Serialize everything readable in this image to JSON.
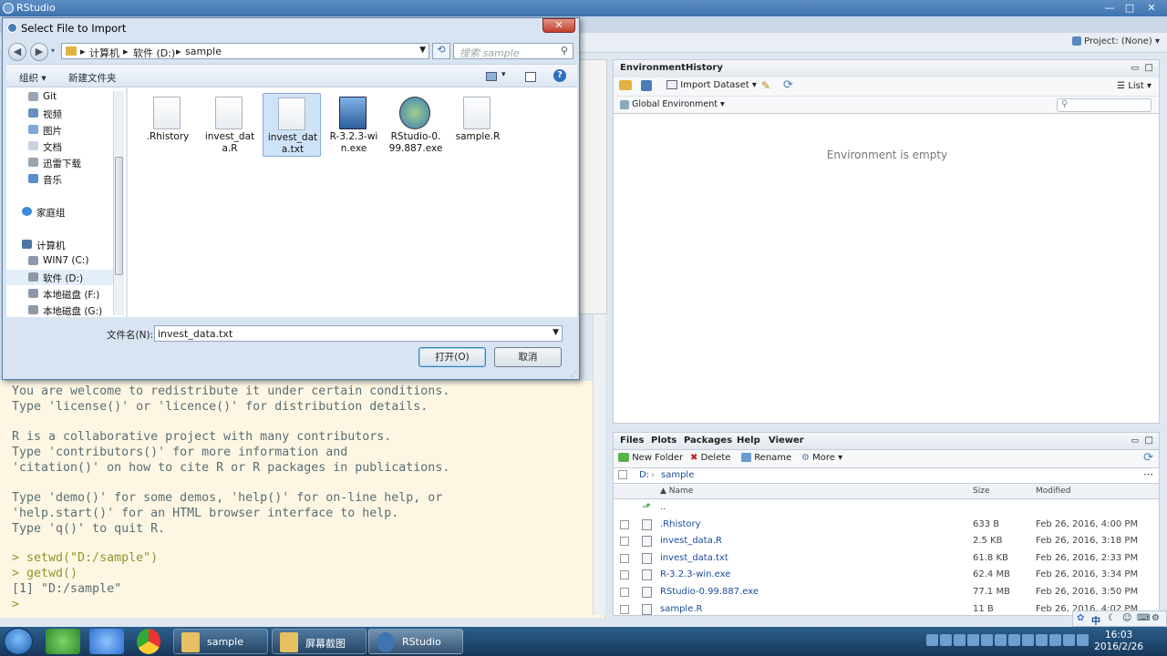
{
  "app": {
    "title": "RStudio",
    "project_label": "Project: (None)"
  },
  "env_pane": {
    "tabs": [
      "Environment",
      "History"
    ],
    "import_label": "Import Dataset",
    "list_label": "List",
    "scope_label": "Global Environment",
    "empty_text": "Environment is empty"
  },
  "files_pane": {
    "tabs": [
      "Files",
      "Plots",
      "Packages",
      "Help",
      "Viewer"
    ],
    "tools": {
      "new_folder": "New Folder",
      "delete": "Delete",
      "rename": "Rename",
      "more": "More"
    },
    "path": [
      "D:",
      "sample"
    ],
    "columns": {
      "name": "Name",
      "size": "Size",
      "modified": "Modified"
    },
    "parent_label": "..",
    "rows": [
      {
        "name": ".Rhistory",
        "size": "633 B",
        "modified": "Feb 26, 2016, 4:00 PM"
      },
      {
        "name": "invest_data.R",
        "size": "2.5 KB",
        "modified": "Feb 26, 2016, 3:18 PM"
      },
      {
        "name": "invest_data.txt",
        "size": "61.8 KB",
        "modified": "Feb 26, 2016, 2:33 PM"
      },
      {
        "name": "R-3.2.3-win.exe",
        "size": "62.4 MB",
        "modified": "Feb 26, 2016, 3:34 PM"
      },
      {
        "name": "RStudio-0.99.887.exe",
        "size": "77.1 MB",
        "modified": "Feb 26, 2016, 3:50 PM"
      },
      {
        "name": "sample.R",
        "size": "11 B",
        "modified": "Feb 26, 2016, 4:02 PM"
      }
    ]
  },
  "console": {
    "lines": [
      "You are welcome to redistribute it under certain conditions.",
      "Type 'license()' or 'licence()' for distribution details.",
      "",
      "R is a collaborative project with many contributors.",
      "Type 'contributors()' for more information and",
      "'citation()' on how to cite R or R packages in publications.",
      "",
      "Type 'demo()' for some demos, 'help()' for on-line help, or",
      "'help.start()' for an HTML browser interface to help.",
      "Type 'q()' to quit R."
    ],
    "cmd1": "> setwd(\"D:/sample\")",
    "cmd2": "> getwd()",
    "out1": "[1] \"D:/sample\"",
    "prompt": ">"
  },
  "dialog": {
    "title": "Select File to Import",
    "address": [
      "计算机",
      "软件 (D:)",
      "sample"
    ],
    "search_placeholder": "搜索 sample",
    "organize": "组织",
    "new_folder": "新建文件夹",
    "tree": [
      "Git",
      "视频",
      "图片",
      "文档",
      "迅雷下载",
      "音乐",
      "家庭组",
      "计算机",
      "WIN7 (C:)",
      "软件 (D:)",
      "本地磁盘 (F:)",
      "本地磁盘 (G:)"
    ],
    "files": [
      {
        "line1": ".Rhistory",
        "line2": ""
      },
      {
        "line1": "invest_dat",
        "line2": "a.R"
      },
      {
        "line1": "invest_dat",
        "line2": "a.txt"
      },
      {
        "line1": "R-3.2.3-wi",
        "line2": "n.exe"
      },
      {
        "line1": "RStudio-0.",
        "line2": "99.887.exe"
      },
      {
        "line1": "sample.R",
        "line2": ""
      }
    ],
    "filename_label": "文件名(N):",
    "filename_value": "invest_data.txt",
    "open_button": "打开(O)",
    "cancel_button": "取消"
  },
  "taskbar": {
    "items": [
      "sample",
      "屏幕截图",
      "RStudio"
    ],
    "time": "16:03",
    "date": "2016/2/26",
    "ime": "中"
  },
  "colors": {
    "accent": "#3f74b0",
    "console_bg": "#fdf6e3",
    "selection": "#cfe3f8"
  }
}
